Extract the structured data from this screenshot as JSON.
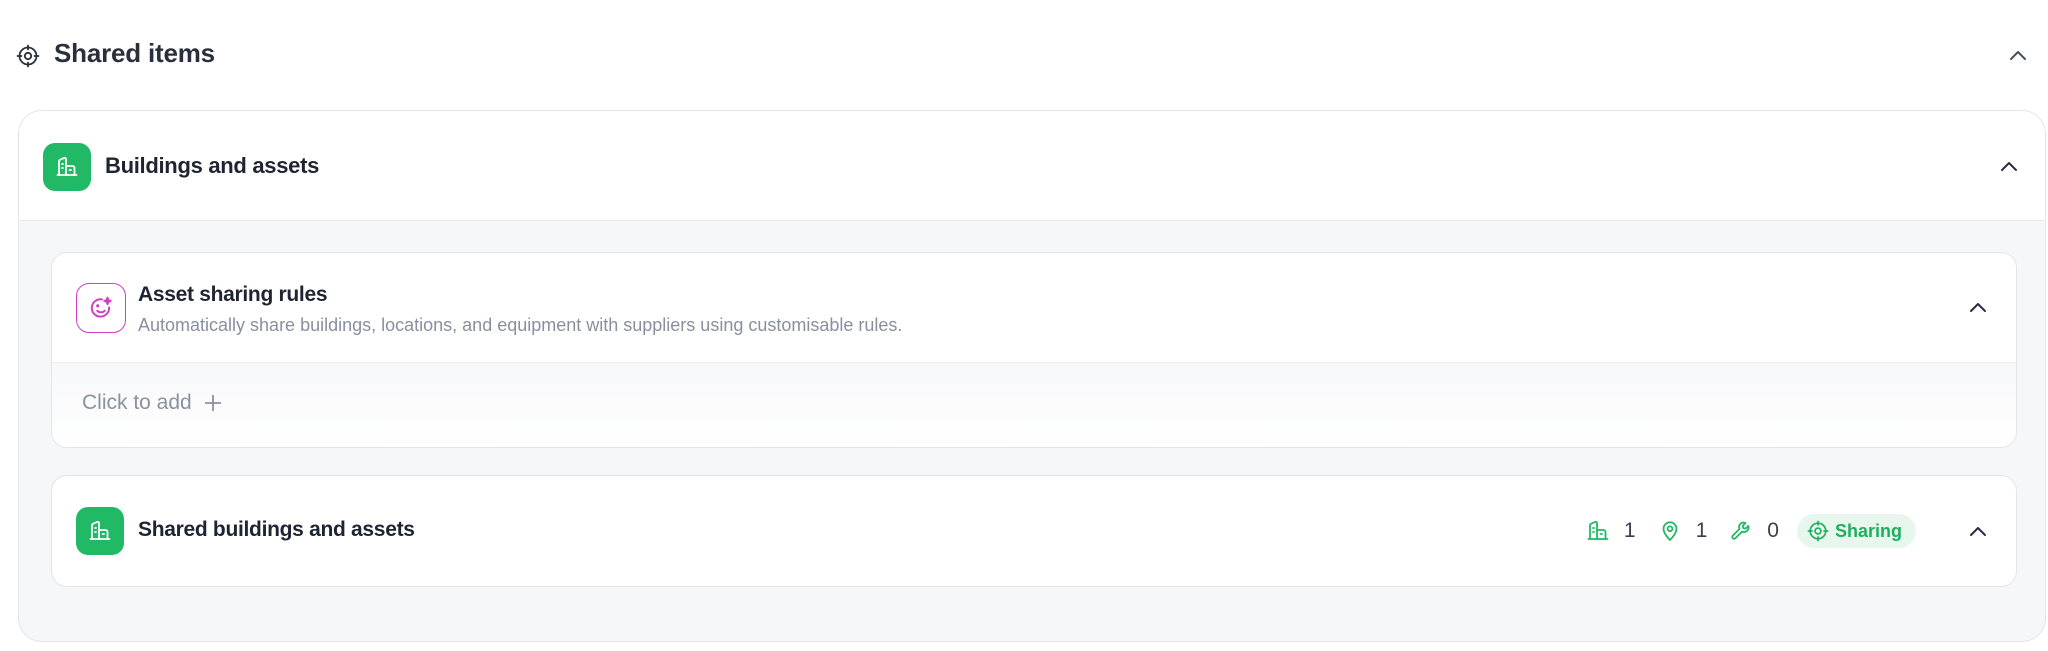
{
  "section": {
    "title": "Shared items",
    "icon": "share-target-icon"
  },
  "buildings": {
    "title": "Buildings and assets",
    "icon": "building-icon",
    "accent": "#21b866"
  },
  "rules": {
    "title": "Asset sharing rules",
    "description": "Automatically share buildings, locations, and equipment with suppliers using customisable rules.",
    "icon": "smiley-sparkle-icon",
    "accent": "#d23fbf",
    "add_label": "Click to add"
  },
  "shared": {
    "title": "Shared buildings and assets",
    "icon": "building-icon",
    "stats": {
      "buildings": "1",
      "locations": "1",
      "equipment": "0"
    },
    "status_label": "Sharing",
    "status_color": "#1fae5f"
  }
}
